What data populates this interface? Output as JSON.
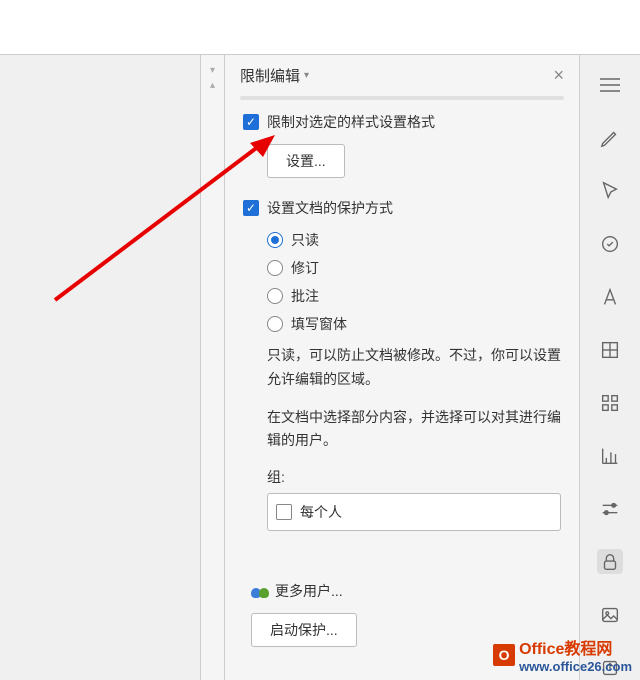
{
  "panel": {
    "title": "限制编辑",
    "close": "×",
    "section1": {
      "checkbox_label": "限制对选定的样式设置格式",
      "settings_btn": "设置..."
    },
    "section2": {
      "checkbox_label": "设置文档的保护方式",
      "radios": {
        "readonly": "只读",
        "revision": "修订",
        "comment": "批注",
        "form": "填写窗体"
      },
      "desc1": "只读，可以防止文档被修改。不过，你可以设置允许编辑的区域。",
      "desc2": "在文档中选择部分内容，并选择可以对其进行编辑的用户。",
      "group_label": "组:",
      "group_option": "每个人",
      "more_users": "更多用户...",
      "start_protect_btn": "启动保护..."
    }
  },
  "watermark": {
    "brand": "Office",
    "suffix": "教程网",
    "url": "www.office26.com"
  }
}
